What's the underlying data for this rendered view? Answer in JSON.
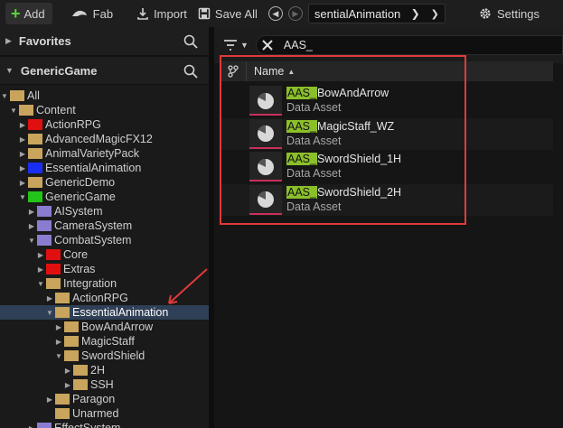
{
  "toolbar": {
    "add_label": "Add",
    "fab_label": "Fab",
    "import_label": "Import",
    "save_all_label": "Save All",
    "path_text": "sentialAnimation",
    "settings_label": "Settings"
  },
  "favorites": {
    "title": "Favorites"
  },
  "project": {
    "title": "GenericGame"
  },
  "tree": [
    {
      "label": "All",
      "color": "#c9a45c",
      "indent": 0,
      "expand": "open"
    },
    {
      "label": "Content",
      "color": "#c9a45c",
      "indent": 1,
      "expand": "open"
    },
    {
      "label": "ActionRPG",
      "color": "#e01010",
      "indent": 2,
      "expand": "closed"
    },
    {
      "label": "AdvancedMagicFX12",
      "color": "#c9a45c",
      "indent": 2,
      "expand": "closed"
    },
    {
      "label": "AnimalVarietyPack",
      "color": "#c9a45c",
      "indent": 2,
      "expand": "closed"
    },
    {
      "label": "EssentialAnimation",
      "color": "#1a2ef0",
      "indent": 2,
      "expand": "closed"
    },
    {
      "label": "GenericDemo",
      "color": "#c9a45c",
      "indent": 2,
      "expand": "closed"
    },
    {
      "label": "GenericGame",
      "color": "#22c41a",
      "indent": 2,
      "expand": "open"
    },
    {
      "label": "AISystem",
      "color": "#8a7cd0",
      "indent": 3,
      "expand": "closed"
    },
    {
      "label": "CameraSystem",
      "color": "#8a7cd0",
      "indent": 3,
      "expand": "closed"
    },
    {
      "label": "CombatSystem",
      "color": "#8a7cd0",
      "indent": 3,
      "expand": "open"
    },
    {
      "label": "Core",
      "color": "#e01010",
      "indent": 4,
      "expand": "closed"
    },
    {
      "label": "Extras",
      "color": "#e01010",
      "indent": 4,
      "expand": "closed"
    },
    {
      "label": "Integration",
      "color": "#c9a45c",
      "indent": 4,
      "expand": "open"
    },
    {
      "label": "ActionRPG",
      "color": "#c9a45c",
      "indent": 5,
      "expand": "closed"
    },
    {
      "label": "EssentialAnimation",
      "color": "#c9a45c",
      "indent": 5,
      "expand": "open",
      "selected": true
    },
    {
      "label": "BowAndArrow",
      "color": "#c9a45c",
      "indent": 6,
      "expand": "closed"
    },
    {
      "label": "MagicStaff",
      "color": "#c9a45c",
      "indent": 6,
      "expand": "closed"
    },
    {
      "label": "SwordShield",
      "color": "#c9a45c",
      "indent": 6,
      "expand": "open"
    },
    {
      "label": "2H",
      "color": "#c9a45c",
      "indent": 7,
      "expand": "closed"
    },
    {
      "label": "SSH",
      "color": "#c9a45c",
      "indent": 7,
      "expand": "closed"
    },
    {
      "label": "Paragon",
      "color": "#c9a45c",
      "indent": 5,
      "expand": "closed"
    },
    {
      "label": "Unarmed",
      "color": "#c9a45c",
      "indent": 5,
      "expand": "none"
    },
    {
      "label": "EffectSystem",
      "color": "#8a7cd0",
      "indent": 3,
      "expand": "closed"
    }
  ],
  "filter": {
    "value": "AAS_"
  },
  "columns": {
    "name": "Name"
  },
  "assets": [
    {
      "prefix": "AAS_",
      "rest": "BowAndArrow",
      "type": "Data Asset"
    },
    {
      "prefix": "AAS_",
      "rest": "MagicStaff_WZ",
      "type": "Data Asset"
    },
    {
      "prefix": "AAS_",
      "rest": "SwordShield_1H",
      "type": "Data Asset"
    },
    {
      "prefix": "AAS_",
      "rest": "SwordShield_2H",
      "type": "Data Asset"
    }
  ],
  "colors": {
    "highlight": "#8bbf2a",
    "annotation": "#e03a3a",
    "selection": "#2f3f55"
  }
}
